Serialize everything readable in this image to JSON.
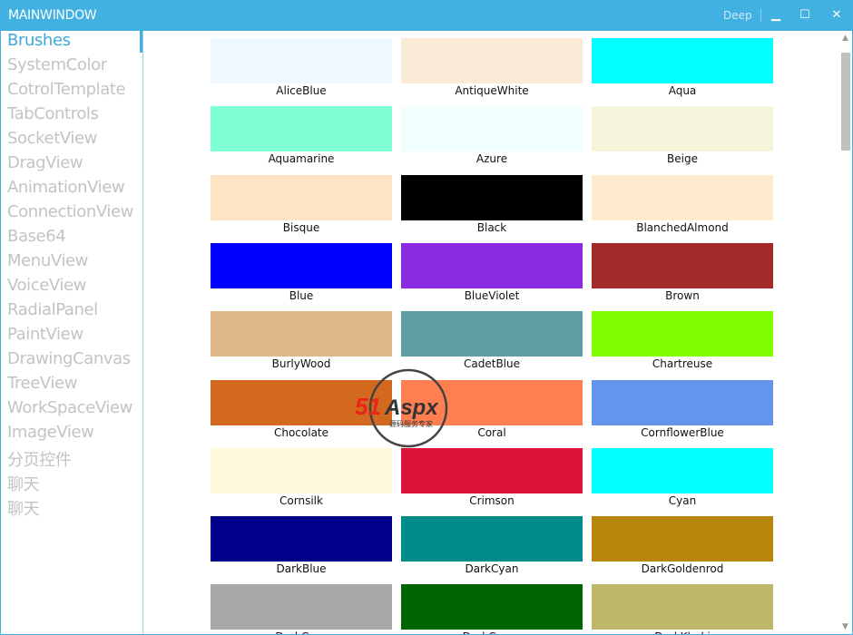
{
  "window": {
    "title": "MAINWINDOW",
    "theme_label": "Deep",
    "minimize": "▁",
    "maximize": "☐",
    "close": "✕"
  },
  "sidebar": {
    "items": [
      "Brushes",
      "SystemColor",
      "CotrolTemplate",
      "TabControls",
      "SocketView",
      "DragView",
      "AnimationView",
      "ConnectionView",
      "Base64",
      "MenuView",
      "VoiceView",
      "RadialPanel",
      "PaintView",
      "DrawingCanvas",
      "TreeView",
      "WorkSpaceView",
      "ImageView",
      "分页控件",
      "聊天",
      "聊天"
    ],
    "selected_index": 0
  },
  "brushes": [
    {
      "name": "AliceBlue",
      "color": "#F0F8FF"
    },
    {
      "name": "AntiqueWhite",
      "color": "#FAEBD7"
    },
    {
      "name": "Aqua",
      "color": "#00FFFF"
    },
    {
      "name": "Aquamarine",
      "color": "#7FFFD4"
    },
    {
      "name": "Azure",
      "color": "#F0FFFF"
    },
    {
      "name": "Beige",
      "color": "#F5F5DC"
    },
    {
      "name": "Bisque",
      "color": "#FFE4C4"
    },
    {
      "name": "Black",
      "color": "#000000"
    },
    {
      "name": "BlanchedAlmond",
      "color": "#FFEBCD"
    },
    {
      "name": "Blue",
      "color": "#0000FF"
    },
    {
      "name": "BlueViolet",
      "color": "#8A2BE2"
    },
    {
      "name": "Brown",
      "color": "#A52A2A"
    },
    {
      "name": "BurlyWood",
      "color": "#DEB887"
    },
    {
      "name": "CadetBlue",
      "color": "#5F9EA0"
    },
    {
      "name": "Chartreuse",
      "color": "#7FFF00"
    },
    {
      "name": "Chocolate",
      "color": "#D2691E"
    },
    {
      "name": "Coral",
      "color": "#FF7F50"
    },
    {
      "name": "CornflowerBlue",
      "color": "#6495ED"
    },
    {
      "name": "Cornsilk",
      "color": "#FFF8DC"
    },
    {
      "name": "Crimson",
      "color": "#DC143C"
    },
    {
      "name": "Cyan",
      "color": "#00FFFF"
    },
    {
      "name": "DarkBlue",
      "color": "#00008B"
    },
    {
      "name": "DarkCyan",
      "color": "#008B8B"
    },
    {
      "name": "DarkGoldenrod",
      "color": "#B8860B"
    },
    {
      "name": "DarkGray",
      "color": "#A9A9A9"
    },
    {
      "name": "DarkGreen",
      "color": "#006400"
    },
    {
      "name": "DarkKhaki",
      "color": "#BDB76B"
    }
  ],
  "watermark": {
    "text": "51Aspx",
    "subtitle": "源码服务专家"
  }
}
